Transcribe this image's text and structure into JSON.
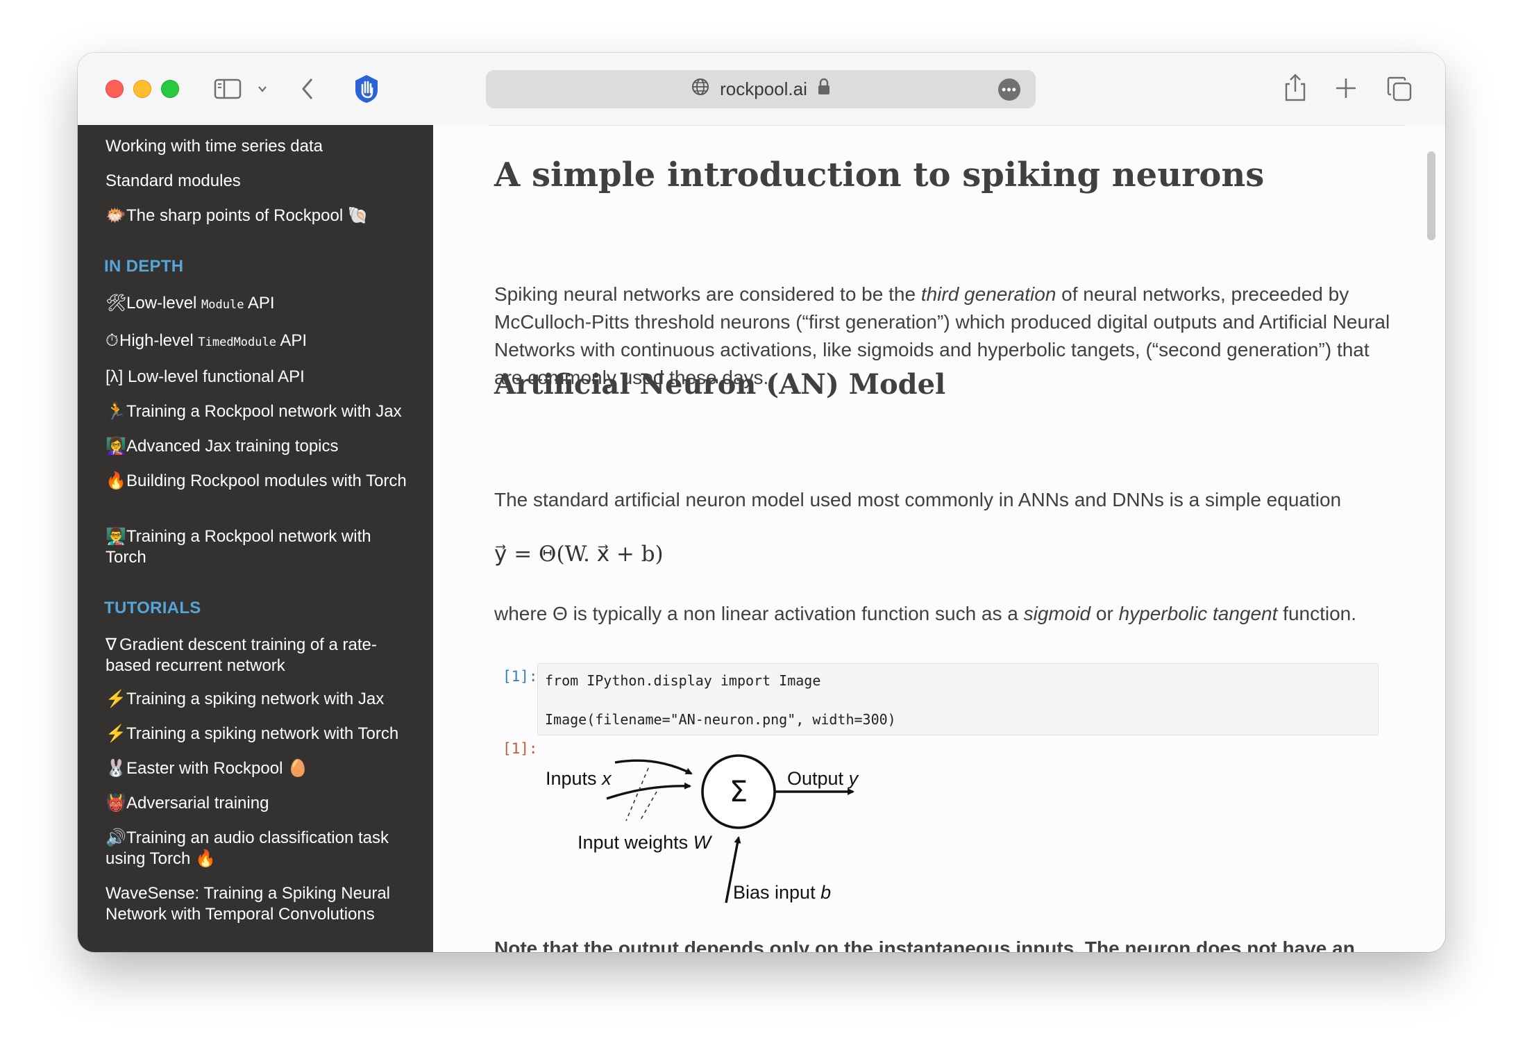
{
  "browser": {
    "url": "rockpool.ai"
  },
  "sidebar": {
    "items_top": [
      {
        "label": "Working with time series data",
        "emoji": ""
      },
      {
        "label": "Standard modules",
        "emoji": ""
      },
      {
        "label": "The sharp points of Rockpool",
        "emoji": "🐡",
        "trail": "🐚"
      }
    ],
    "caption_in_depth": "IN DEPTH",
    "in_depth": [
      {
        "emoji": "🛠",
        "pre": "Low-level ",
        "code": "Module",
        "post": " API"
      },
      {
        "emoji": "⏱",
        "pre": "High-level ",
        "code": "TimedModule",
        "post": " API"
      },
      {
        "emoji": "",
        "pre": "[λ] Low-level functional API",
        "code": "",
        "post": ""
      },
      {
        "emoji": "🏃",
        "pre": "Training a Rockpool network with Jax",
        "code": "",
        "post": ""
      },
      {
        "emoji": "👩‍🏫",
        "pre": "Advanced Jax training topics",
        "code": "",
        "post": ""
      },
      {
        "emoji": "🔥",
        "pre": "Building Rockpool modules with Torch",
        "code": "",
        "post": ""
      },
      {
        "emoji": "👨‍🏫",
        "pre": "Training a Rockpool network with Torch",
        "code": "",
        "post": ""
      }
    ],
    "caption_tutorials": "TUTORIALS",
    "tutorials": [
      {
        "emoji": "∇",
        "label": "Gradient descent training of a rate-based recurrent network"
      },
      {
        "emoji": "⚡",
        "label": "Training a spiking network with Jax"
      },
      {
        "emoji": "⚡",
        "label": "Training a spiking network with Torch"
      },
      {
        "emoji": "🐰",
        "label": "Easter with Rockpool",
        "trail": "🥚"
      },
      {
        "emoji": "👹",
        "label": "Adversarial training"
      },
      {
        "emoji": "🔊",
        "label": "Training an audio classification task using Torch",
        "trail": "🔥"
      },
      {
        "emoji": "",
        "label": "WaveSense: Training a Spiking Neural Network with Temporal Convolutions"
      }
    ]
  },
  "main": {
    "title": "A simple introduction to spiking neurons",
    "intro_1": "Spiking neural networks are considered to be the ",
    "intro_em": "third generation",
    "intro_2": " of neural networks, preceeded by McCulloch-Pitts threshold neurons (“first generation”) which produced digital outputs and Artificial Neural Networks with continuous activations, like sigmoids and hyperbolic tangets, (“second generation”) that are commonly used these days.",
    "heading_an": "Artificial Neuron (AN) Model",
    "an_text": "The standard artificial neuron model used most commonly in ANNs and DNNs is a simple equation",
    "equation": "y⃗ = Θ(W. x⃗ + b)",
    "where_1": "where Θ is typically a non linear activation function such as a ",
    "where_em1": "sigmoid",
    "where_2": " or ",
    "where_em2": "hyperbolic tangent",
    "where_3": " function.",
    "cell_in_prompt": "[1]:",
    "cell_out_prompt": "[1]:",
    "code_line_1": "from IPython.display import Image",
    "code_line_2": "Image(filename=\"AN-neuron.png\", width=300)",
    "diagram": {
      "inputs": "Inputs ",
      "inputs_var": "x",
      "output": "Output ",
      "output_var": "y",
      "weights": "Input weights ",
      "weights_var": "W",
      "bias": "Bias input ",
      "bias_var": "b",
      "sum": "Σ"
    },
    "note": "Note that the output depends only on the instantaneous inputs. The neuron does not have an internal state that would affect its output."
  }
}
